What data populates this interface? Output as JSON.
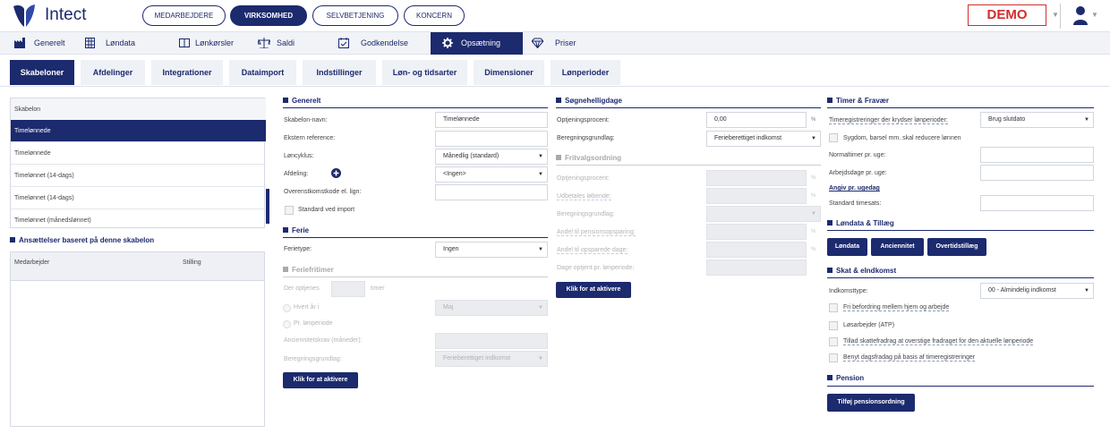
{
  "app": {
    "name": "Intect",
    "demo_label": "DEMO"
  },
  "top_pills": [
    "MEDARBEJDERE",
    "VIRKSOMHED",
    "SELVBETJENING",
    "KONCERN"
  ],
  "main_nav": [
    "Generelt",
    "Løndata",
    "Lønkørsler",
    "Saldi",
    "Godkendelse",
    "Opsætning",
    "Priser"
  ],
  "sub_tabs": [
    "Skabeloner",
    "Afdelinger",
    "Integrationer",
    "Dataimport",
    "Indstillinger",
    "Løn- og tidsarter",
    "Dimensioner",
    "Lønperioder"
  ],
  "templates": {
    "header": "Skabelon",
    "items": [
      "Timelønnede",
      "Timelønnede",
      "Timelønnet (14-dags)",
      "Timelønnet (14-dags)",
      "Timelønnet (månedslønnet)"
    ]
  },
  "employments": {
    "title": "Ansættelser baseret på denne skabelon",
    "col_employee": "Medarbejder",
    "col_position": "Stilling"
  },
  "generelt": {
    "title": "Generelt",
    "name_label": "Skabelon-navn:",
    "name_value": "Timelønnede",
    "extref_label": "Ekstern reference:",
    "extref_value": "",
    "cycle_label": "Løncyklus:",
    "cycle_value": "Månedlig (standard)",
    "dept_label": "Afdeling:",
    "dept_value": "<Ingen>",
    "agreement_label": "Overenstkomstkode el. lign:",
    "agreement_value": "",
    "default_import_label": "Standard ved import"
  },
  "ferie": {
    "title": "Ferie",
    "type_label": "Ferietype:",
    "type_value": "Ingen"
  },
  "feriefritimer": {
    "title": "Feriefritimer",
    "earned_label": "Der optjenes",
    "earned_unit": "timer",
    "earned_value": "",
    "yearly_label": "Hvert år i",
    "month_value": "Maj",
    "period_label": "Pr. lønperiode",
    "seniority_label": "Anciennitetskrav (måneder):",
    "seniority_value": "",
    "basis_label": "Beregningsgrundlag:",
    "basis_value": "Ferieberettiget indkomst",
    "activate_label": "Klik for at aktivere"
  },
  "sognehelligdage": {
    "title": "Søgnehelligdage",
    "pct_label": "Optjeningsprocent:",
    "pct_value": "0,00",
    "pct_unit": "%",
    "basis_label": "Beregningsgrundlag:",
    "basis_value": "Ferieberettiget indkomst"
  },
  "fritvalg": {
    "title": "Fritvalgsordning",
    "pct_label": "Optjeningsprocent:",
    "paid_label": "Udbetales løbende:",
    "basis_label": "Beregningsgrundlag:",
    "pension_label": "Andel til pensionsopsparing:",
    "days_label": "Andel til opsparede dage:",
    "earned_days_label": "Dage optjent pr. lønperiode:",
    "pct_unit": "%",
    "activate_label": "Klik for at aktivere"
  },
  "timer": {
    "title": "Timer & Fravær",
    "crossing_label": "Timeregistreringer der krydser lønperioder:",
    "crossing_value": "Brug slutdato",
    "sick_label": "Sygdom, barsel mm. skal reducere lønnen",
    "normal_hours_label": "Normaltimer pr. uge:",
    "workdays_label": "Arbejdsdage pr. uge:",
    "weekday_link": "Angiv pr. ugedag",
    "std_rate_label": "Standard timesats:"
  },
  "londata": {
    "title": "Løndata & Tillæg",
    "buttons": [
      "Løndata",
      "Anciennitet",
      "Overtidstillæg"
    ]
  },
  "skat": {
    "title": "Skat & eIndkomst",
    "income_type_label": "Indkomsttype:",
    "income_type_value": "00 - Almindelig indkomst",
    "checks": [
      "Fri befordring mellem hjem og arbejde",
      "Løsarbejder (ATP)",
      "Tillad skattefradrag at overstige fradraget for den aktuelle lønperiode",
      "Benyt dagsfradag på basis af timeregistreringer"
    ]
  },
  "pension": {
    "title": "Pension",
    "add_label": "Tilføj pensionsordning"
  },
  "colors": {
    "brand": "#1c2a6e",
    "demo": "#d32d2d"
  }
}
